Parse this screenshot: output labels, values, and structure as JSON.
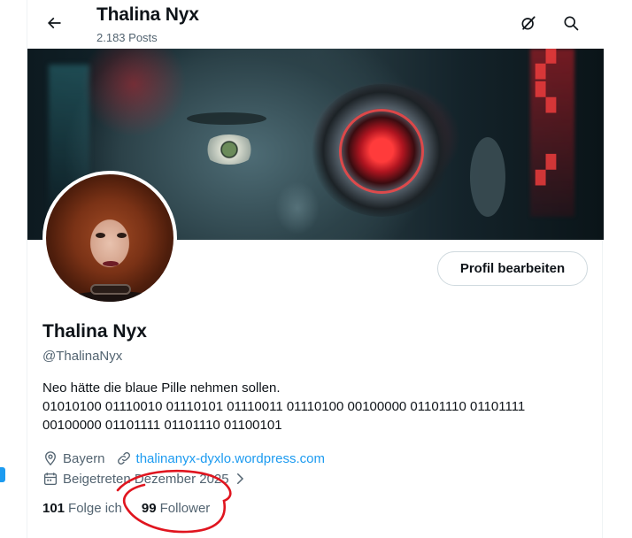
{
  "header": {
    "title": "Thalina Nyx",
    "post_count": "2.183 Posts"
  },
  "profile": {
    "display_name": "Thalina Nyx",
    "handle": "@ThalinaNyx",
    "edit_button": "Profil bearbeiten",
    "bio_lines": [
      "Neo hätte die blaue Pille nehmen sollen.",
      "01010100 01110010 01110101 01110011 01110100 00100000 01101110 01101111",
      "00100000 01101111 01101110 01100101"
    ],
    "location": "Bayern",
    "website": "thalinanyx-dyxlo.wordpress.com",
    "joined": "Beigetreten Dezember 2025",
    "following_count": "101",
    "following_label": "Folge ich",
    "followers_count": "99",
    "followers_label": "Follower"
  },
  "icons": {
    "back": "arrow-left-icon",
    "grok": "grok-icon",
    "search": "search-icon",
    "location": "location-pin-icon",
    "link": "link-icon",
    "calendar": "calendar-icon",
    "chevron": "chevron-right-icon"
  },
  "colors": {
    "accent": "#1d9bf0",
    "text_primary": "#0f1419",
    "text_secondary": "#536471",
    "annotation_red": "#e0151f"
  }
}
